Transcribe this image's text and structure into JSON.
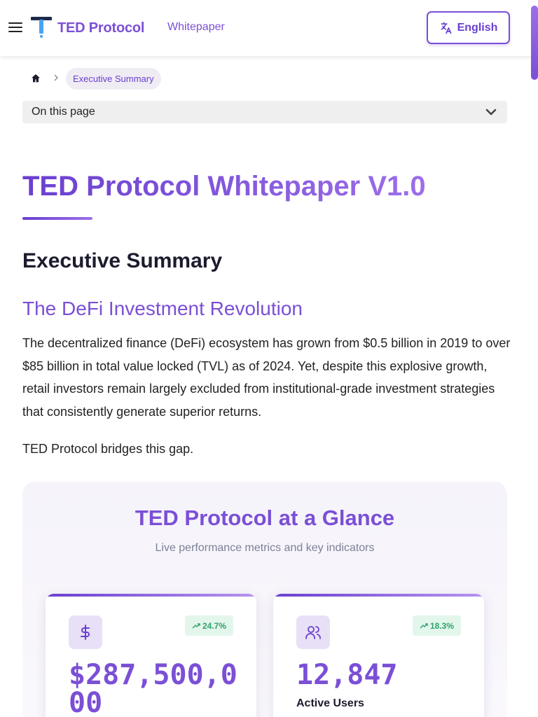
{
  "header": {
    "logo_text": "TED Protocol",
    "nav_link": "Whitepaper",
    "language_label": "English"
  },
  "breadcrumb": {
    "current": "Executive Summary"
  },
  "on_this_page": {
    "label": "On this page"
  },
  "main": {
    "title": "TED Protocol Whitepaper V1.0",
    "section_title": "Executive Summary",
    "subsection_title": "The DeFi Investment Revolution",
    "paragraph": "The decentralized finance (DeFi) ecosystem has grown from $0.5 billion in 2019 to over $85 billion in total value locked (TVL) as of 2024. Yet, despite this explosive growth, retail investors remain largely excluded from institutional-grade investment strategies that consistently generate superior returns.",
    "paragraph2": "TED Protocol bridges this gap."
  },
  "glance": {
    "title": "TED Protocol at a Glance",
    "subtitle": "Live performance metrics and key indicators",
    "cards": [
      {
        "icon": "dollar-icon",
        "badge": "24.7%",
        "value": "$287,500,000",
        "label": ""
      },
      {
        "icon": "users-icon",
        "badge": "18.3%",
        "value": "12,847",
        "label": "Active Users"
      }
    ]
  },
  "colors": {
    "accent": "#7b4fd6",
    "accent_dark": "#6a3fd0",
    "positive": "#2ea36a",
    "positive_bg": "#e3f6ec"
  }
}
